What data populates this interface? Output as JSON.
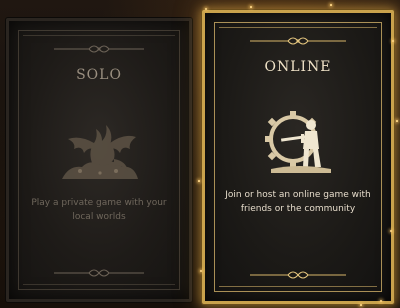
{
  "cards": {
    "solo": {
      "title": "SOLO",
      "description": "Play a private game with your local worlds",
      "emblem_icon": "dragon-icon"
    },
    "online": {
      "title": "ONLINE",
      "description": "Join or host an online game with friends or the community",
      "emblem_icon": "knight-gear-icon"
    }
  },
  "colors": {
    "accent_gold": "#c9a24c",
    "inactive_text": "#9a8f80",
    "active_text": "#f0e3c8"
  }
}
